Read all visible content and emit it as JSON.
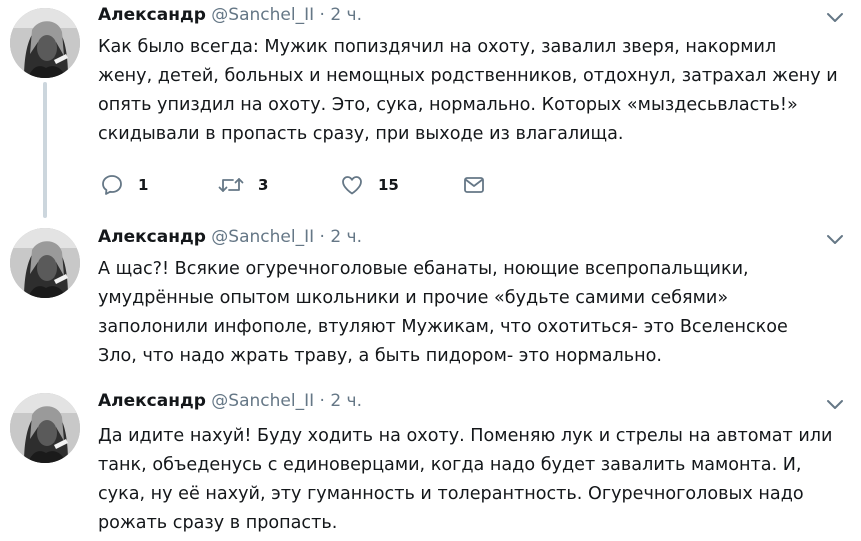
{
  "tweets": [
    {
      "author_name": "Александр",
      "author_handle": "@Sanchel_II",
      "separator": "·",
      "time": "2 ч.",
      "lines": [
        "Как было всегда: Мужик попиздячил на охоту, завалил зверя, накормил",
        "жену, детей, больных и немощных родственников, отдохнул, затрахал жену и",
        "опять упиздил на охоту. Это, сука, нормально. Которых «мыздесьвласть!»",
        "скидывали в пропасть сразу, при выходе из влагалища."
      ],
      "actions": {
        "reply_count": "1",
        "retweet_count": "3",
        "like_count": "15"
      },
      "icons": [
        "reply-icon",
        "retweet-icon",
        "like-icon",
        "message-icon",
        "chevron-down-icon"
      ]
    },
    {
      "author_name": "Александр",
      "author_handle": "@Sanchel_II",
      "separator": "·",
      "time": "2 ч.",
      "lines": [
        "А щас?! Всякие огуречноголовые ебанаты, ноющие всепропальщики,",
        "умудрённые опытом школьники и прочие «будьте самими себями»",
        "заполонили инфополе, втуляют Мужикам, что охотиться- это Вселенское",
        "Зло, что надо жрать траву, а быть пидором- это нормально."
      ]
    },
    {
      "author_name": "Александр",
      "author_handle": "@Sanchel_II",
      "separator": "·",
      "time": "2 ч.",
      "lines": [
        "Да идите нахуй!  Буду ходить на охоту. Поменяю лук и стрелы на автомат или",
        "танк, объеденусь с единоверцами, когда надо будет завалить мамонта. И,",
        "сука, ну её нахуй, эту гуманность и толерантность. Огуречноголовых надо",
        "рожать сразу в пропасть."
      ]
    }
  ],
  "colors": {
    "text": "#14171a",
    "secondary": "#657786",
    "thread_line": "#ccd6dd",
    "background": "#ffffff"
  }
}
